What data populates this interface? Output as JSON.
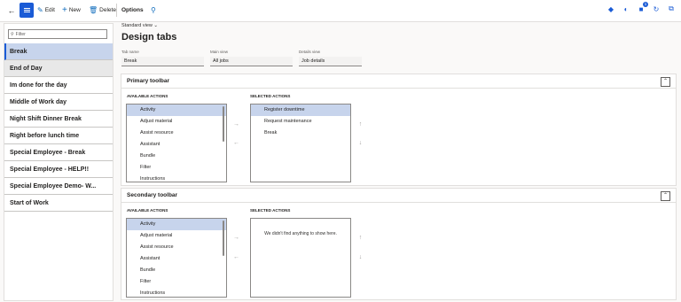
{
  "toolbar": {
    "edit_label": "Edit",
    "new_label": "New",
    "delete_label": "Delete",
    "options_label": "Options",
    "notification_count": "1"
  },
  "sidebar": {
    "filter_placeholder": "Filter",
    "items": [
      "Break",
      "End of Day",
      "Im done for the day",
      "Middle of Work day",
      "Night Shift Dinner Break",
      "Right before lunch time",
      "Special Employee - Break",
      "Special Employee - HELP!!",
      "Special Employee Demo- W...",
      "Start of Work"
    ]
  },
  "header": {
    "view_label": "Standard view",
    "title": "Design tabs"
  },
  "fields": {
    "tab_name_label": "Tab name",
    "tab_name_value": "Break",
    "main_view_label": "Main view",
    "main_view_value": "All jobs",
    "details_view_label": "Details view",
    "details_view_value": "Job details"
  },
  "primary": {
    "title": "Primary toolbar",
    "available_label": "AVAILABLE ACTIONS",
    "selected_label": "SELECTED ACTIONS",
    "available": [
      "Activity",
      "Adjust material",
      "Assist resource",
      "Assistant",
      "Bundle",
      "Filter",
      "Instructions"
    ],
    "selected": [
      "Register downtime",
      "Request maintenance",
      "Break"
    ]
  },
  "secondary": {
    "title": "Secondary toolbar",
    "available_label": "AVAILABLE ACTIONS",
    "selected_label": "SELECTED ACTIONS",
    "available": [
      "Activity",
      "Adjust material",
      "Assist resource",
      "Assistant",
      "Bundle",
      "Filter",
      "Instructions"
    ],
    "empty_text": "We didn't find anything to show here."
  }
}
